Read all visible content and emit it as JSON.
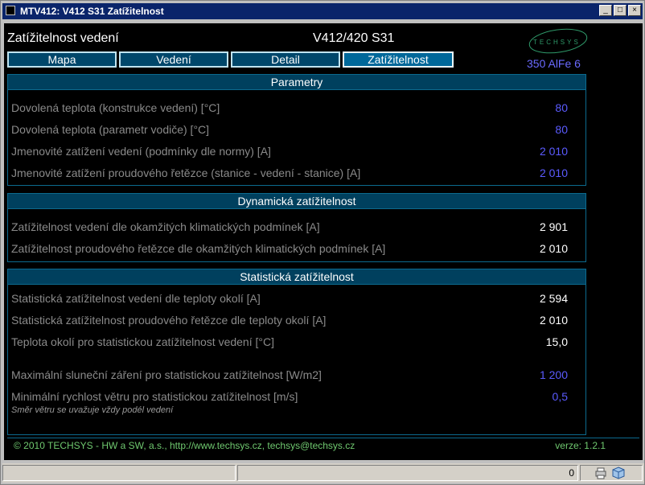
{
  "window": {
    "title": "MTV412: V412 S31 Zatížitelnost",
    "minimize": "_",
    "maximize": "□",
    "close": "×"
  },
  "header": {
    "title": "Zatížitelnost vedení",
    "center": "V412/420 S31",
    "right": "350 AlFe 6",
    "logo_text": "TECHSYS"
  },
  "tabs": [
    {
      "label": "Mapa",
      "active": false
    },
    {
      "label": "Vedení",
      "active": false
    },
    {
      "label": "Detail",
      "active": false
    },
    {
      "label": "Zatížitelnost",
      "active": true
    }
  ],
  "parametry": {
    "heading": "Parametry",
    "rows": [
      {
        "label": "Dovolená teplota (konstrukce vedení) [°C]",
        "value": "80"
      },
      {
        "label": "Dovolená teplota (parametr vodiče) [°C]",
        "value": "80"
      },
      {
        "label": "Jmenovité zatížení vedení (podmínky dle normy) [A]",
        "value": "2 010"
      },
      {
        "label": "Jmenovité zatížení proudového řetězce (stanice - vedení - stanice) [A]",
        "value": "2 010"
      }
    ]
  },
  "dynamicka": {
    "heading": "Dynamická zatížitelnost",
    "rows": [
      {
        "label": "Zatížitelnost vedení dle okamžitých klimatických podmínek [A]",
        "value": "2 901"
      },
      {
        "label": "Zatížitelnost proudového řetězce dle okamžitých klimatických podmínek [A]",
        "value": "2 010"
      }
    ]
  },
  "staticka": {
    "heading": "Statistická zatížitelnost",
    "rows": [
      {
        "label": "Statistická zatížitelnost vedení dle teploty okolí [A]",
        "value": "2 594"
      },
      {
        "label": "Statistická zatížitelnost proudového řetězce dle teploty okolí [A]",
        "value": "2 010"
      },
      {
        "label": "Teplota okolí pro statistickou zatížitelnost vedení [°C]",
        "value": "15,0"
      },
      {
        "label": "Maximální sluneční záření pro statistickou zatížitelnost [W/m2]",
        "value": "1 200"
      },
      {
        "label": "Minimální rychlost větru pro statistickou zatížitelnost [m/s]",
        "value": "0,5"
      }
    ],
    "note": "Směr větru se uvažuje vždy podél vedení"
  },
  "footer": {
    "copyright": "© 2010 TECHSYS - HW a SW, a.s.,   http://www.techsys.cz,   techsys@techsys.cz",
    "version": "verze:  1.2.1"
  },
  "statusbar": {
    "count": "0"
  },
  "colors": {
    "title_bar": "#0a246a",
    "panel_border": "#0c6a8e",
    "value_blue": "#5b5bff",
    "footer_green": "#6fc86f"
  }
}
